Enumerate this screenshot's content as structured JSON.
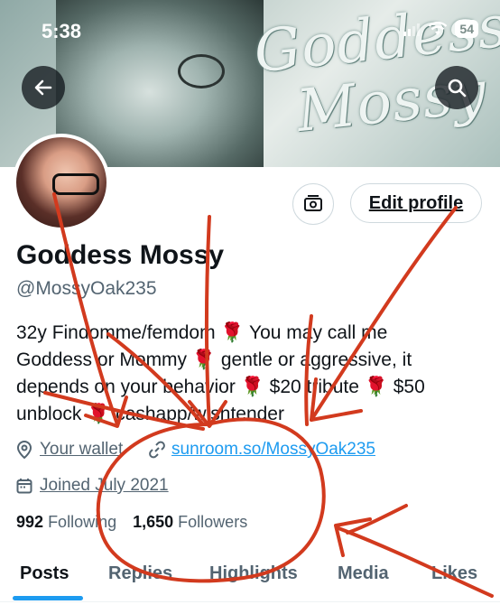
{
  "status_bar": {
    "time": "5:38",
    "battery": "54"
  },
  "banner": {
    "title_line1": "Goddess",
    "title_line2": "Mossy"
  },
  "profile": {
    "display_name": "Goddess Mossy",
    "handle": "@MossyOak235",
    "edit_button": "Edit profile",
    "bio_line1": "32y Findomme/femdom 🌹 You may call me",
    "bio_line2": "Goddess or Mommy 🌹 gentle or aggressive, it",
    "bio_line3": "depends on your behavior 🌹 $20 tribute 🌹 $50",
    "bio_line4": "unblock 🌹 cashapp/wishtender",
    "wallet_label": "Your wallet",
    "website": "sunroom.so/MossyOak235",
    "joined": "Joined July 2021",
    "following_count": "992",
    "following_label": "Following",
    "followers_count": "1,650",
    "followers_label": "Followers"
  },
  "tabs": [
    {
      "label": "Posts"
    },
    {
      "label": "Replies"
    },
    {
      "label": "Highlights"
    },
    {
      "label": "Media"
    },
    {
      "label": "Likes"
    }
  ],
  "colors": {
    "accent": "#1d9bf0",
    "annotation": "#d23a1e",
    "secondary_text": "#536471"
  },
  "icons": [
    "back-arrow-icon",
    "search-icon",
    "subscriptions-icon",
    "location-icon",
    "link-icon",
    "calendar-icon",
    "wifi-icon",
    "signal-icon",
    "battery-icon"
  ]
}
